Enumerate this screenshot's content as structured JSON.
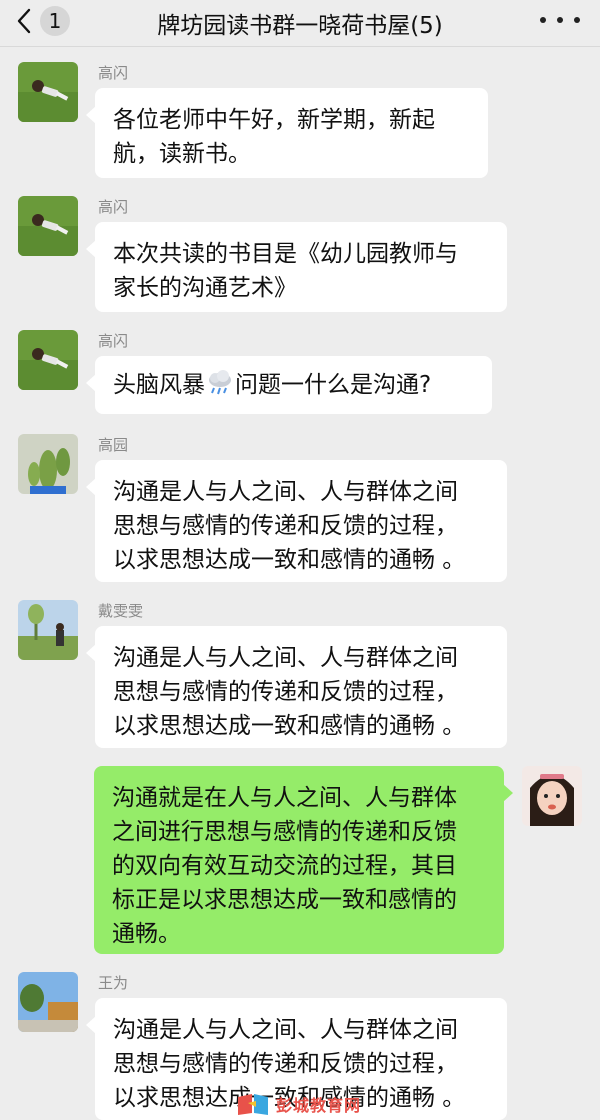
{
  "header": {
    "back_badge": "1",
    "title": "牌坊园读书群一晓荷书屋(5)"
  },
  "messages": [
    {
      "sender": "高闪",
      "text": "各位老师中午好，新学期，新起\n航，读新书。"
    },
    {
      "sender": "高闪",
      "text": "本次共读的书目是《幼儿园教师与\n家长的沟通艺术》"
    },
    {
      "sender": "高闪",
      "text": "头脑风暴",
      "emoji": "cloud-rain-emoji",
      "text_after": "问题一什么是沟通?"
    },
    {
      "sender": "高园",
      "text": "沟通是人与人之间、人与群体之间\n思想与感情的传递和反馈的过程，\n以求思想达成一致和感情的通畅 。"
    },
    {
      "sender": "戴雯雯",
      "text": "沟通是人与人之间、人与群体之间\n思想与感情的传递和反馈的过程，\n以求思想达成一致和感情的通畅 。"
    },
    {
      "sender": "",
      "self": true,
      "text": "沟通就是在人与人之间、人与群体\n之间进行思想与感情的传递和反馈\n的双向有效互动交流的过程，其目\n标正是以求思想达成一致和感情的\n通畅。"
    },
    {
      "sender": "王为",
      "text": "沟通是人与人之间、人与群体之间\n思想与感情的传递和反馈的过程，\n以求思想达成一致和感情的通畅 。"
    }
  ],
  "watermark": {
    "text": "彭城教育网"
  },
  "colors": {
    "background": "#ededed",
    "self_bubble": "#95ec69",
    "other_bubble": "#ffffff",
    "sender_name": "#8a8a8a"
  }
}
